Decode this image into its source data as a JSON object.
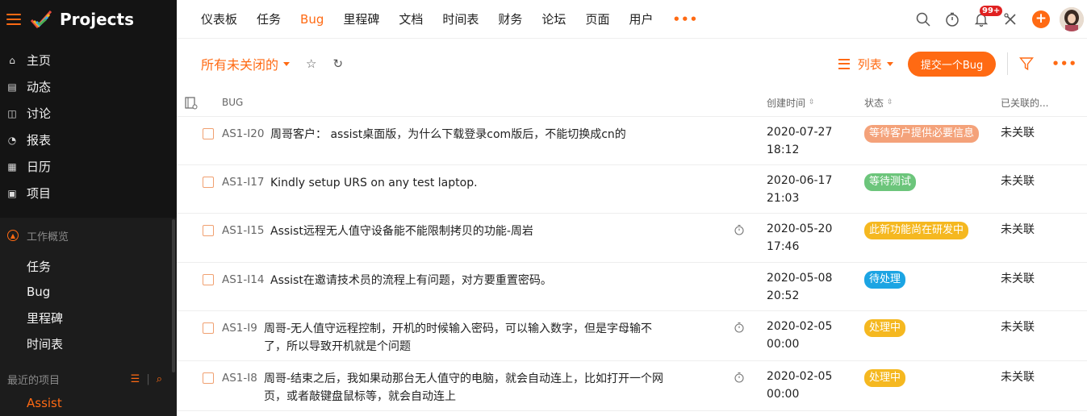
{
  "app": {
    "logo_text": "Projects"
  },
  "sidebar": {
    "main_items": [
      {
        "label": "主页",
        "icon": "home-icon"
      },
      {
        "label": "动态",
        "icon": "feed-icon"
      },
      {
        "label": "讨论",
        "icon": "discussion-icon"
      },
      {
        "label": "报表",
        "icon": "reports-icon"
      },
      {
        "label": "日历",
        "icon": "calendar-icon"
      },
      {
        "label": "项目",
        "icon": "projects-icon"
      }
    ],
    "work_overview": {
      "label": "工作概览",
      "items": [
        "任务",
        "Bug",
        "里程碑",
        "时间表"
      ]
    },
    "recent": {
      "label": "最近的项目",
      "project": "Assist"
    }
  },
  "topnav": {
    "tabs": [
      "仪表板",
      "任务",
      "Bug",
      "里程碑",
      "文档",
      "时间表",
      "财务",
      "论坛",
      "页面",
      "用户"
    ],
    "active_tab": "Bug",
    "more": "•••",
    "notification_badge": "99+"
  },
  "toolbar": {
    "view_label": "所有未关闭的",
    "list_view_label": "列表",
    "submit_button": "提交一个Bug",
    "more": "•••"
  },
  "table": {
    "headers": {
      "bug": "BUG",
      "created": "创建时间",
      "status": "状态",
      "linked": "已关联的..."
    },
    "rows": [
      {
        "id": "AS1-I20",
        "title": "周哥客户： assist桌面版，为什么下载登录com版后，不能切换成cn的",
        "timer": false,
        "date": "2020-07-27",
        "time": "18:12",
        "status": "等待客户提供必要信息",
        "status_color": "#f4a27a",
        "linked": "未关联"
      },
      {
        "id": "AS1-I17",
        "title": "Kindly setup URS on any test laptop.",
        "timer": false,
        "date": "2020-06-17",
        "time": "21:03",
        "status": "等待测试",
        "status_color": "#6cc57b",
        "linked": "未关联"
      },
      {
        "id": "AS1-I15",
        "title": "Assist远程无人值守设备能不能限制拷贝的功能-周岩",
        "timer": true,
        "date": "2020-05-20",
        "time": "17:46",
        "status": "此新功能尚在研发中",
        "status_color": "#f5b820",
        "linked": "未关联"
      },
      {
        "id": "AS1-I14",
        "title": "Assist在邀请技术员的流程上有问题，对方要重置密码。",
        "timer": false,
        "date": "2020-05-08",
        "time": "20:52",
        "status": "待处理",
        "status_color": "#1ba4e3",
        "linked": "未关联"
      },
      {
        "id": "AS1-I9",
        "title_lines": [
          "周哥-无人值守远程控制，开机的时候输入密码，可以输入数字，但是字母输不",
          "了，所以导致开机就是个问题"
        ],
        "timer": true,
        "date": "2020-02-05",
        "time": "00:00",
        "status": "处理中",
        "status_color": "#f5b820",
        "linked": "未关联"
      },
      {
        "id": "AS1-I8",
        "title_lines": [
          "周哥-结束之后，我如果动那台无人值守的电脑，就会自动连上，比如打开一个网",
          "页，或者敲键盘鼠标等，就会自动连上"
        ],
        "timer": true,
        "date": "2020-02-05",
        "time": "00:00",
        "status": "处理中",
        "status_color": "#f5b820",
        "linked": "未关联"
      }
    ]
  }
}
